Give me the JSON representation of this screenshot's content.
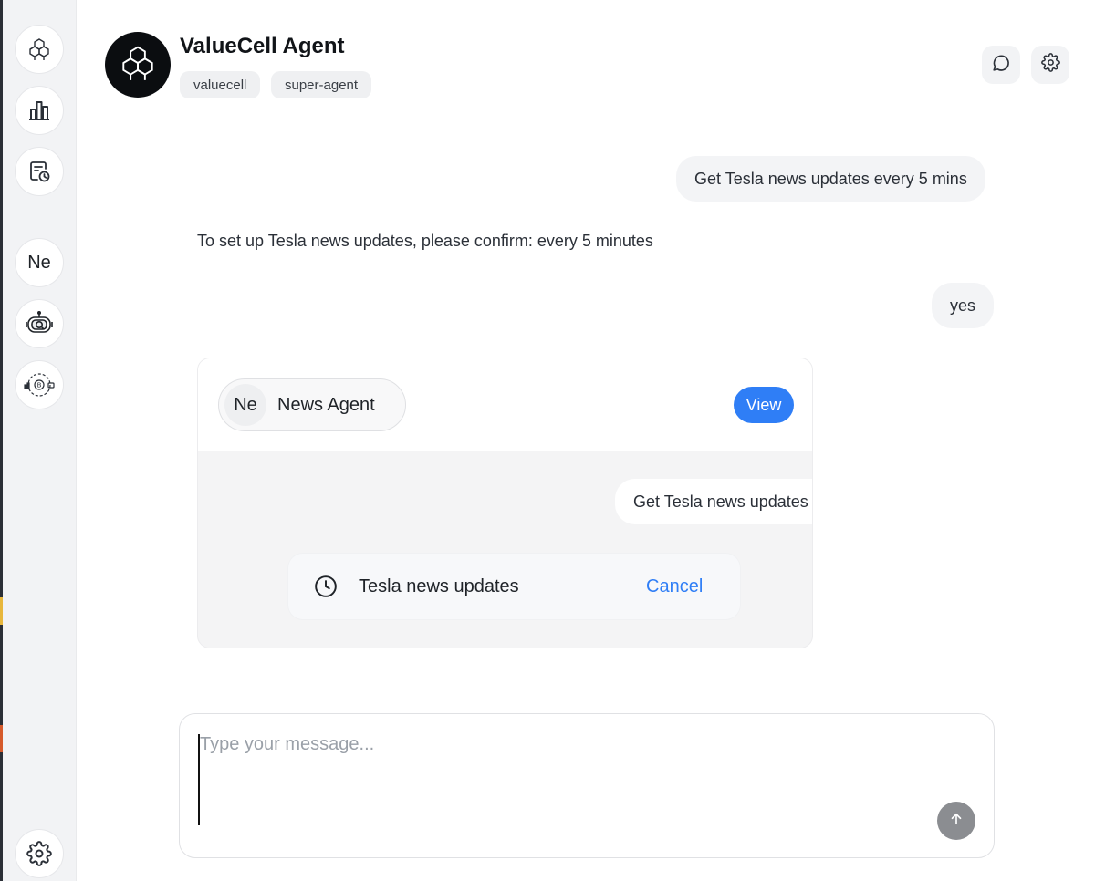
{
  "sidebar": {
    "items": [
      {
        "name": "valuecell-logo",
        "icon": "cube-network-icon"
      },
      {
        "name": "market-chart",
        "icon": "bar-chart-icon"
      },
      {
        "name": "scheduled-tasks",
        "icon": "calendar-clock-icon"
      }
    ],
    "agents": [
      {
        "label": "Ne"
      },
      {
        "icon": "robot-search-icon"
      },
      {
        "icon": "crypto-cycle-icon"
      }
    ],
    "settings_icon": "gear-icon"
  },
  "header": {
    "title": "ValueCell Agent",
    "tags": [
      "valuecell",
      "super-agent"
    ],
    "actions": [
      "chat-icon",
      "gear-icon"
    ]
  },
  "conversation": {
    "user_message_1": "Get Tesla news updates every 5 mins",
    "agent_reply_1": "To set up Tesla news updates, please confirm: every 5 minutes",
    "user_message_2": "yes"
  },
  "task_card": {
    "agent_initials": "Ne",
    "agent_name": "News Agent",
    "view_label": "View",
    "inner_message": "Get Tesla news updates",
    "schedule_label": "Tesla news updates",
    "cancel_label": "Cancel"
  },
  "composer": {
    "placeholder": "Type your message..."
  },
  "colors": {
    "accent": "#2f7ef6",
    "sidebar_bg": "#f2f3f5",
    "send_button": "#8b8d91"
  }
}
